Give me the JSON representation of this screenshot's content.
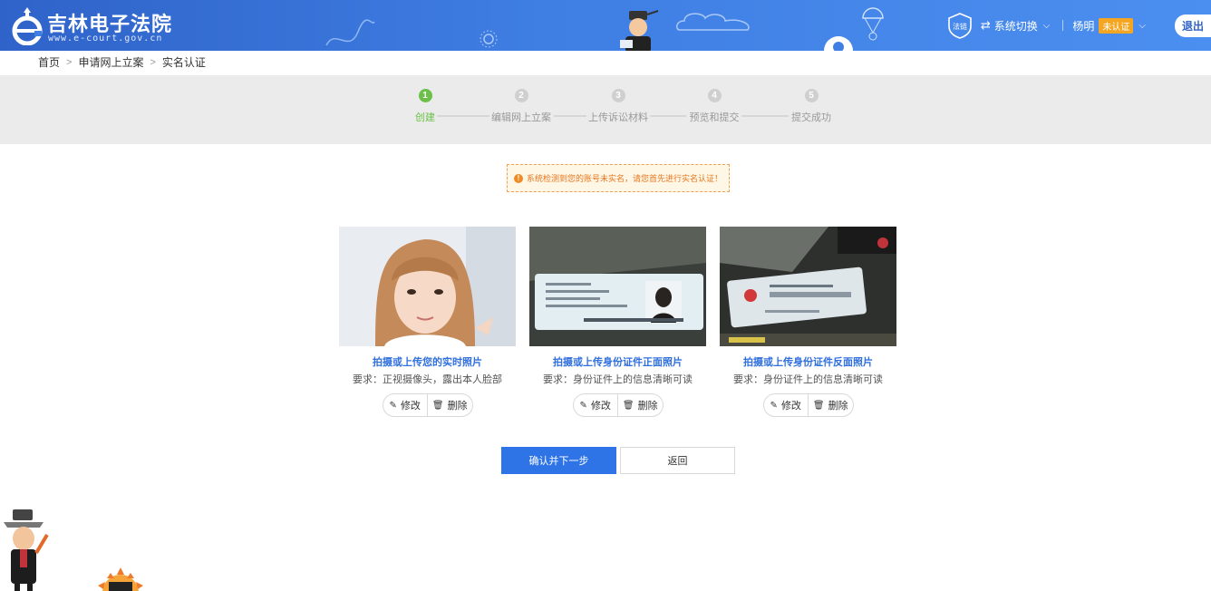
{
  "header": {
    "title": "吉林电子法院",
    "url": "www.e-court.gov.cn",
    "chain_badge": "法链",
    "system_switch": "系统切换",
    "user_name": "杨明",
    "user_badge": "未认证",
    "logout": "退出"
  },
  "breadcrumb": {
    "items": [
      "首页",
      "申请网上立案",
      "实名认证"
    ]
  },
  "steps": [
    {
      "num": "1",
      "label": "创建",
      "active": true
    },
    {
      "num": "2",
      "label": "编辑网上立案",
      "active": false
    },
    {
      "num": "3",
      "label": "上传诉讼材料",
      "active": false
    },
    {
      "num": "4",
      "label": "预览和提交",
      "active": false
    },
    {
      "num": "5",
      "label": "提交成功",
      "active": false
    }
  ],
  "notice": {
    "text": "系统检测到您的账号未实名，请您首先进行实名认证！"
  },
  "cards": [
    {
      "title": "拍摄或上传您的实时照片",
      "requirement": "要求：正视摄像头，露出本人脸部",
      "edit": "修改",
      "delete": "删除"
    },
    {
      "title": "拍摄或上传身份证件正面照片",
      "requirement": "要求：身份证件上的信息清晰可读",
      "edit": "修改",
      "delete": "删除"
    },
    {
      "title": "拍摄或上传身份证件反面照片",
      "requirement": "要求：身份证件上的信息清晰可读",
      "edit": "修改",
      "delete": "删除"
    }
  ],
  "actions": {
    "confirm": "确认并下一步",
    "back": "返回"
  },
  "colors": {
    "header_blue": "#3f7ee3",
    "step_active": "#6cc04a",
    "link_blue": "#2f6fde",
    "primary_button": "#2f74e6",
    "notice_orange": "#e6761c"
  }
}
